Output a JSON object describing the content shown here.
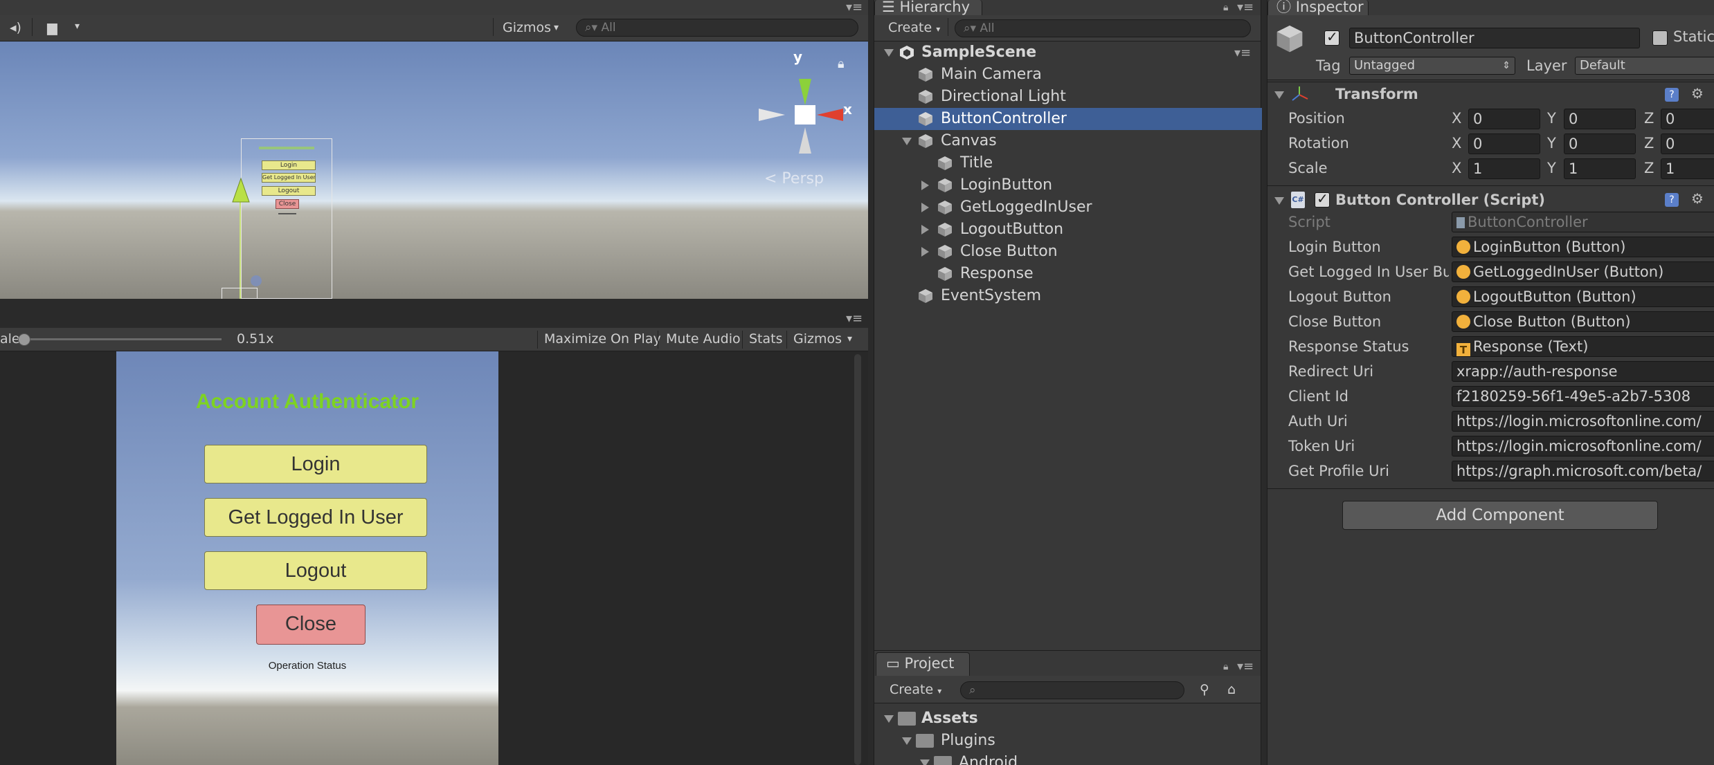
{
  "scene_view": {
    "toolbar": {
      "gizmos_label": "Gizmos",
      "search_placeholder": "All"
    },
    "gizmo": {
      "y_label": "y",
      "x_label": "x",
      "persp_label": "< Persp"
    },
    "mini_buttons": [
      "Login",
      "Get Logged In User",
      "Logout",
      "Close"
    ]
  },
  "game_view": {
    "toolbar": {
      "scale_label": "ale",
      "scale_value": "0.51x",
      "maximize_label": "Maximize On Play",
      "mute_label": "Mute Audio",
      "stats_label": "Stats",
      "gizmos_label": "Gizmos"
    },
    "title": "Account Authenticator",
    "buttons": {
      "login": "Login",
      "get_logged_in_user": "Get Logged In User",
      "logout": "Logout",
      "close": "Close"
    },
    "status": "Operation Status",
    "colors": {
      "title": "#7ed321",
      "button": "#e8e88c",
      "close": "#e89595"
    }
  },
  "hierarchy": {
    "tab": "Hierarchy",
    "create_label": "Create",
    "search_placeholder": "All",
    "scene": "SampleScene",
    "items": {
      "main_camera": "Main Camera",
      "directional_light": "Directional Light",
      "button_controller": "ButtonController",
      "canvas": "Canvas",
      "title": "Title",
      "login_button": "LoginButton",
      "get_logged_in_user": "GetLoggedInUser",
      "logout_button": "LogoutButton",
      "close_button": "Close Button",
      "response": "Response",
      "event_system": "EventSystem"
    },
    "selected_color": "#3e5f96"
  },
  "project": {
    "tab": "Project",
    "create_label": "Create",
    "assets": "Assets",
    "plugins": "Plugins",
    "android": "Android"
  },
  "inspector": {
    "tab": "Inspector",
    "object_name": "ButtonController",
    "static_label": "Static",
    "tag_label": "Tag",
    "tag_value": "Untagged",
    "layer_label": "Layer",
    "layer_value": "Default",
    "transform": {
      "title": "Transform",
      "position_label": "Position",
      "rotation_label": "Rotation",
      "scale_label": "Scale",
      "x_label": "X",
      "y_label": "Y",
      "z_label": "Z",
      "position": [
        "0",
        "0",
        "0"
      ],
      "rotation": [
        "0",
        "0",
        "0"
      ],
      "scale": [
        "1",
        "1",
        "1"
      ]
    },
    "script_component": {
      "title": "Button Controller (Script)",
      "script_label": "Script",
      "script_value": "ButtonController",
      "login_label": "Login Button",
      "login_value": "LoginButton (Button)",
      "get_label": "Get Logged In User Bu",
      "get_value": "GetLoggedInUser (Button)",
      "logout_label": "Logout Button",
      "logout_value": "LogoutButton (Button)",
      "close_label": "Close Button",
      "close_value": "Close Button (Button)",
      "response_label": "Response Status",
      "response_value": "Response (Text)",
      "redirect_label": "Redirect Uri",
      "redirect_value": "xrapp://auth-response",
      "client_label": "Client Id",
      "client_value": "f2180259-56f1-49e5-a2b7-5308",
      "auth_label": "Auth Uri",
      "auth_value": "https://login.microsoftonline.com/",
      "token_label": "Token Uri",
      "token_value": "https://login.microsoftonline.com/",
      "profile_label": "Get Profile Uri",
      "profile_value": "https://graph.microsoft.com/beta/"
    },
    "add_component": "Add Component"
  }
}
